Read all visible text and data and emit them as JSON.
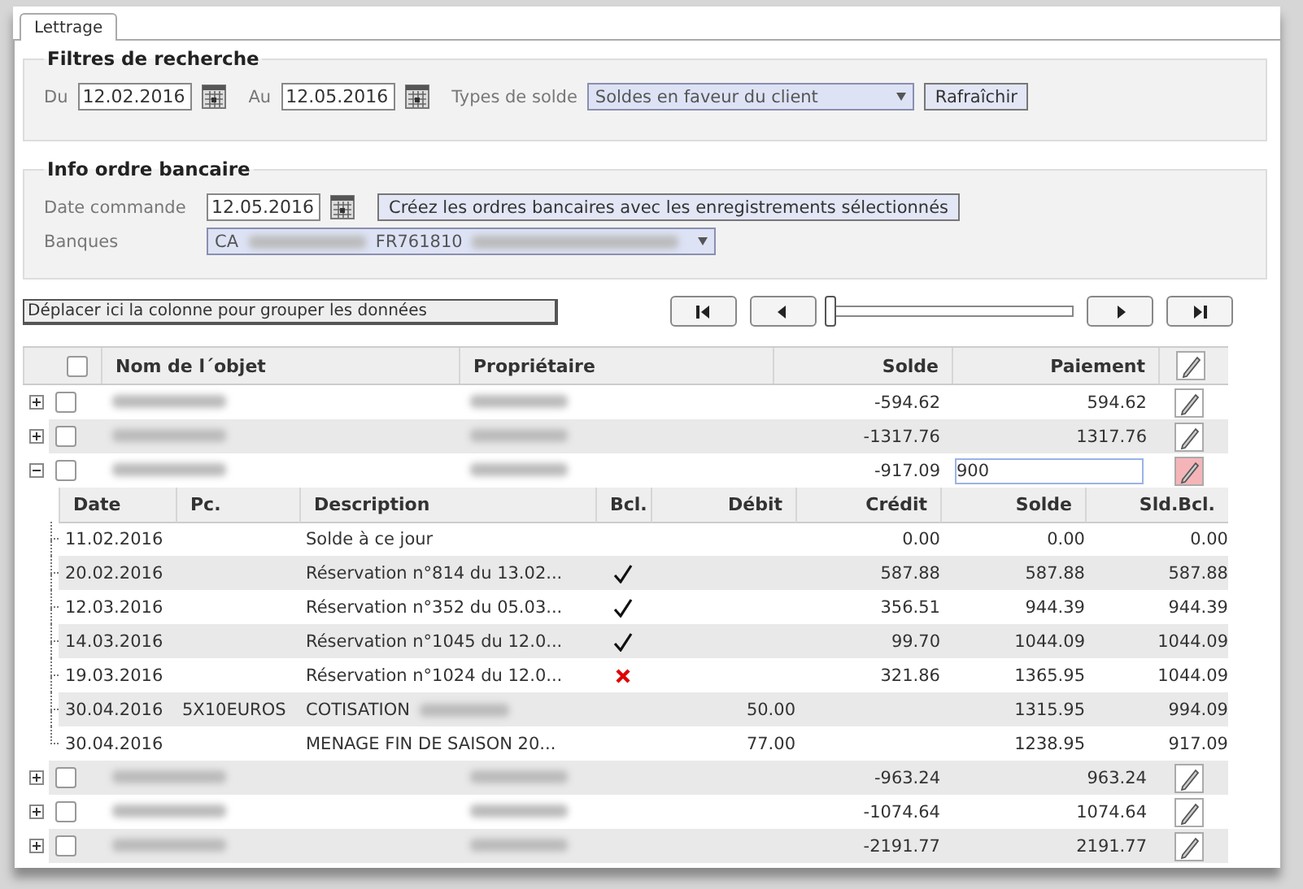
{
  "tabs": [
    {
      "label": "Lettrage",
      "selected": true
    }
  ],
  "search_filters": {
    "title": "Filtres de recherche",
    "from_label": "Du",
    "from_value": "12.02.2016",
    "to_label": "Au",
    "to_value": "12.05.2016",
    "balance_type_label": "Types de solde",
    "balance_type_value": "Soldes en faveur du client",
    "refresh_button": "Rafraîchir"
  },
  "bank_order": {
    "title": "Info ordre bancaire",
    "date_label": "Date commande",
    "date_value": "12.05.2016",
    "create_button": "Créez les ordres bancaires avec les enregistrements sélectionnés",
    "banks_label": "Banques",
    "bank_parts": [
      "CA",
      "FR761810"
    ]
  },
  "group_panel": "Déplacer ici la colonne pour grouper les données",
  "pager": {
    "level": 0
  },
  "grid": {
    "select_all_checked": false,
    "columns": [
      "Nom de l´objet",
      "Propriétaire",
      "Solde",
      "Paiement"
    ],
    "rows": [
      {
        "expanded": false,
        "checked": false,
        "solde": "-594.62",
        "paiement": "594.62",
        "editing": false
      },
      {
        "expanded": false,
        "checked": false,
        "solde": "-1317.76",
        "paiement": "1317.76",
        "editing": false
      },
      {
        "expanded": true,
        "checked": false,
        "solde": "-917.09",
        "paiement": "900",
        "editing": true,
        "details": {
          "columns": [
            "Date",
            "Pc.",
            "Description",
            "Bcl.",
            "Débit",
            "Crédit",
            "Solde",
            "Sld.Bcl."
          ],
          "rows": [
            {
              "date": "11.02.2016",
              "description": "Solde à ce jour",
              "credit": "0.00",
              "solde": "0.00",
              "sld_bcl": "0.00"
            },
            {
              "date": "20.02.2016",
              "description": "Réservation n°814 du 13.02...",
              "bcl_ok": true,
              "credit": "587.88",
              "solde": "587.88",
              "sld_bcl": "587.88"
            },
            {
              "date": "12.03.2016",
              "description": "Réservation n°352 du 05.03...",
              "bcl_ok": true,
              "credit": "356.51",
              "solde": "944.39",
              "sld_bcl": "944.39"
            },
            {
              "date": "14.03.2016",
              "description": "Réservation n°1045 du 12.0...",
              "bcl_ok": true,
              "credit": "99.70",
              "solde": "1044.09",
              "sld_bcl": "1044.09"
            },
            {
              "date": "19.03.2016",
              "description": "Réservation n°1024 du 12.0...",
              "bcl_ok": false,
              "credit": "321.86",
              "solde": "1365.95",
              "sld_bcl": "1044.09"
            },
            {
              "date": "30.04.2016",
              "pc": "5X10EUROS",
              "description": "COTISATION",
              "description_blurred": true,
              "debit": "50.00",
              "solde": "1315.95",
              "sld_bcl": "994.09"
            },
            {
              "date": "30.04.2016",
              "description": "MENAGE FIN DE SAISON 20...",
              "debit": "77.00",
              "solde": "1238.95",
              "sld_bcl": "917.09"
            }
          ]
        }
      },
      {
        "expanded": false,
        "checked": false,
        "solde": "-963.24",
        "paiement": "963.24",
        "editing": false
      },
      {
        "expanded": false,
        "checked": false,
        "solde": "-1074.64",
        "paiement": "1074.64",
        "editing": false
      },
      {
        "expanded": false,
        "checked": false,
        "solde": "-2191.77",
        "paiement": "2191.77",
        "editing": false
      }
    ]
  }
}
